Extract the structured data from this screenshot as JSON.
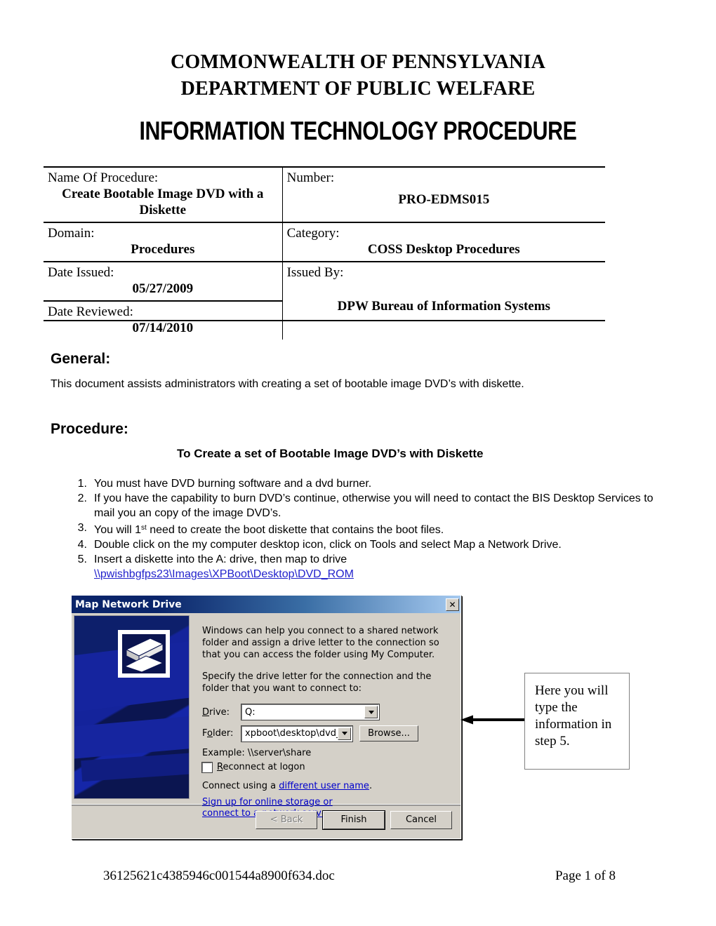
{
  "header": {
    "org_line1": "COMMONWEALTH OF PENNSYLVANIA",
    "org_line2": "DEPARTMENT OF PUBLIC WELFARE",
    "doc_type": "INFORMATION TECHNOLOGY PROCEDURE"
  },
  "info_table": {
    "name_label": "Name Of Procedure:",
    "name_value": "Create Bootable Image DVD with a Diskette",
    "number_label": "Number:",
    "number_value": "PRO-EDMS015",
    "domain_label": "Domain:",
    "domain_value": "Procedures",
    "category_label": "Category:",
    "category_value": "COSS Desktop Procedures",
    "date_issued_label": "Date Issued:",
    "date_issued_value": "05/27/2009",
    "issued_by_label": "Issued By:",
    "issued_by_value": "DPW Bureau of Information Systems",
    "date_reviewed_label": "Date Reviewed:",
    "date_reviewed_value": "07/14/2010"
  },
  "general": {
    "heading": "General:",
    "body": "This document assists administrators with creating a set of bootable image DVD’s with diskette."
  },
  "procedure": {
    "heading": "Procedure:",
    "subtitle": "To Create a set of Bootable Image DVD’s with Diskette",
    "steps": [
      {
        "num": "1.",
        "text": "You must have DVD burning software and a dvd burner."
      },
      {
        "num": "2.",
        "text": "If you have the capability to burn DVD’s continue, otherwise you will need to contact the BIS Desktop Services to mail you an copy of the image DVD’s."
      },
      {
        "num": "3.",
        "text_before": "You will 1",
        "superscript": "st",
        "text_after": " need to create the boot diskette that contains the boot files."
      },
      {
        "num": "4.",
        "text": "Double click on the my computer desktop icon, click on Tools and select Map a Network Drive."
      },
      {
        "num": "5.",
        "text": "Insert a diskette into the A: drive, then map to drive",
        "link": "\\\\pwishbgfps23\\Images\\XPBoot\\Desktop\\DVD_ROM"
      }
    ]
  },
  "dialog": {
    "title": "Map Network Drive",
    "close_label": "✕",
    "paragraph1": "Windows can help you connect to a shared network folder and assign a drive letter to the connection so that you can access the folder using My Computer.",
    "paragraph2": "Specify the drive letter for the connection and the folder that you want to connect to:",
    "drive_label": "Drive:",
    "drive_value": "Q:",
    "folder_label": "Folder:",
    "folder_value": "xpboot\\desktop\\dvd_rom",
    "browse_label": "Browse...",
    "example_text": "Example: \\\\server\\share",
    "reconnect_label": "Reconnect at logon",
    "connect_prefix": "Connect using a ",
    "connect_link": "different user name",
    "connect_suffix": ".",
    "signup_link": "Sign up for online storage or connect to a network server",
    "signup_suffix": ".",
    "back_label": "< Back",
    "finish_label": "Finish",
    "cancel_label": "Cancel"
  },
  "callout": {
    "text": "Here you will type the information in step 5."
  },
  "footer": {
    "filename": "36125621c4385946c001544a8900f634.doc",
    "page": "Page 1 of 8"
  },
  "colors": {
    "link_blue": "#2222cc",
    "dialog_face": "#d4d0c8",
    "titlebar_dark": "#0a246a",
    "titlebar_light": "#a6caf0",
    "art_navy": "#0b1550"
  }
}
